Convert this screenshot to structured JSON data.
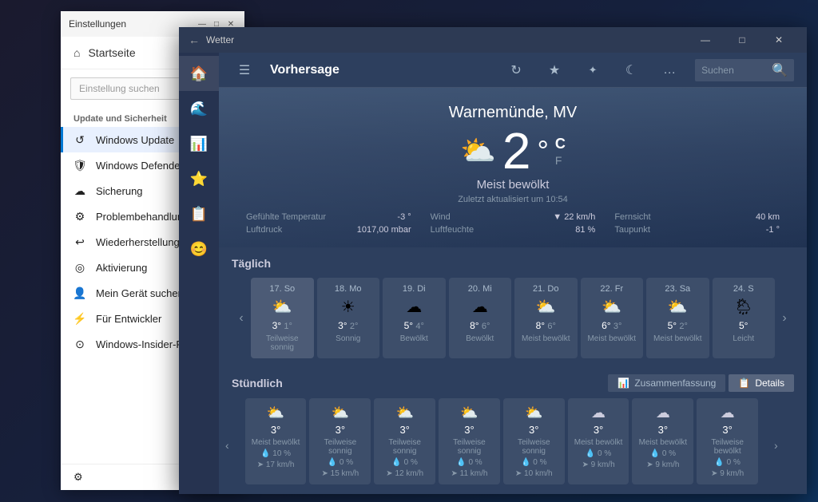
{
  "desktop": {
    "bg": "#1a1a2e"
  },
  "settings": {
    "title": "Einstellungen",
    "home_label": "Startseite",
    "search_placeholder": "Einstellung suchen",
    "section_label": "Update und Sicherheit",
    "nav_items": [
      {
        "id": "windows-update",
        "icon": "↺",
        "label": "Windows Update",
        "active": true
      },
      {
        "id": "windows-defender",
        "icon": "🛡",
        "label": "Windows Defender",
        "active": false
      },
      {
        "id": "sicherung",
        "icon": "↑",
        "label": "Sicherung",
        "active": false
      },
      {
        "id": "problembehandlung",
        "icon": "⚙",
        "label": "Problembehandlung",
        "active": false
      },
      {
        "id": "wiederherstellung",
        "icon": "↩",
        "label": "Wiederherstellung",
        "active": false
      },
      {
        "id": "aktivierung",
        "icon": "◎",
        "label": "Aktivierung",
        "active": false
      },
      {
        "id": "mein-gerat",
        "icon": "👤",
        "label": "Mein Gerät suchen",
        "active": false
      },
      {
        "id": "entwickler",
        "icon": "⚡",
        "label": "Für Entwickler",
        "active": false
      },
      {
        "id": "windows-insider",
        "icon": "⊙",
        "label": "Windows-Insider-Pr...",
        "active": false
      }
    ],
    "bottom_icon": "⚙",
    "bottom_label": ""
  },
  "weather": {
    "titlebar": {
      "back_icon": "←",
      "title": "Wetter",
      "min_icon": "—",
      "max_icon": "□",
      "close_icon": "✕"
    },
    "topbar": {
      "menu_icon": "☰",
      "title": "Vorhersage",
      "refresh_icon": "↻",
      "favorites_icon": "★",
      "settings_icon": "✦",
      "moon_icon": "☾",
      "more_icon": "…",
      "search_placeholder": "Suchen",
      "search_icon": "🔍"
    },
    "sidebar_icons": [
      "🏠",
      "🌊",
      "📊",
      "⭐",
      "📋",
      "😊"
    ],
    "hero": {
      "location": "Warnemünde, MV",
      "temp": "2",
      "unit_c": "C",
      "unit_f": "F",
      "condition": "Meist bewölkt",
      "updated": "Zuletzt aktualisiert um 10:54",
      "details": [
        {
          "label": "Gefühlte Temperatur",
          "value": "-3 °"
        },
        {
          "label": "Wind",
          "value": "▼ 22 km/h"
        },
        {
          "label": "Fernsicht",
          "value": "40 km"
        },
        {
          "label": "Luftdruck",
          "value": "1017,00 mbar"
        },
        {
          "label": "Luftfeuchte",
          "value": "81 %"
        },
        {
          "label": "Taupunkt",
          "value": "-1 °"
        }
      ]
    },
    "daily": {
      "title": "Täglich",
      "days": [
        {
          "name": "17. So",
          "icon": "⛅",
          "high": "3°",
          "low": "1°",
          "label": "Teilweise sonnig",
          "today": true
        },
        {
          "name": "18. Mo",
          "icon": "☀",
          "high": "3°",
          "low": "2°",
          "label": "Sonnig",
          "today": false
        },
        {
          "name": "19. Di",
          "icon": "☁",
          "high": "5°",
          "low": "4°",
          "label": "Bewölkt",
          "today": false
        },
        {
          "name": "20. Mi",
          "icon": "☁",
          "high": "8°",
          "low": "6°",
          "label": "Bewölkt",
          "today": false
        },
        {
          "name": "21. Do",
          "icon": "⛅",
          "high": "8°",
          "low": "6°",
          "label": "Meist bewölkt",
          "today": false
        },
        {
          "name": "22. Fr",
          "icon": "⛅",
          "high": "6°",
          "low": "3°",
          "label": "Meist bewölkt",
          "today": false
        },
        {
          "name": "23. Sa",
          "icon": "⛅",
          "high": "5°",
          "low": "2°",
          "label": "Meist bewölkt",
          "today": false
        },
        {
          "name": "24. S",
          "icon": "🌦",
          "high": "5°",
          "low": "",
          "label": "Leicht",
          "today": false
        }
      ]
    },
    "hourly": {
      "title": "Stündlich",
      "tab_summary": "Zusammenfassung",
      "tab_details": "Details",
      "tab_summary_icon": "📊",
      "tab_details_icon": "📋",
      "hours": [
        {
          "icon": "⛅",
          "temp": "3°",
          "label": "Meist bewölkt",
          "rain": "10 %",
          "wind": "17 km/h"
        },
        {
          "icon": "⛅",
          "temp": "3°",
          "label": "Teilweise sonnig",
          "rain": "0 %",
          "wind": "15 km/h"
        },
        {
          "icon": "⛅",
          "temp": "3°",
          "label": "Teilweise sonnig",
          "rain": "0 %",
          "wind": "12 km/h"
        },
        {
          "icon": "⛅",
          "temp": "3°",
          "label": "Teilweise sonnig",
          "rain": "0 %",
          "wind": "11 km/h"
        },
        {
          "icon": "⛅",
          "temp": "3°",
          "label": "Teilweise sonnig",
          "rain": "0 %",
          "wind": "10 km/h"
        },
        {
          "icon": "☁",
          "temp": "3°",
          "label": "Meist bewölkt",
          "rain": "0 %",
          "wind": "9 km/h"
        },
        {
          "icon": "☁",
          "temp": "3°",
          "label": "Meist bewölkt",
          "rain": "0 %",
          "wind": "9 km/h"
        },
        {
          "icon": "☁",
          "temp": "3°",
          "label": "Teilweise bewölkt",
          "rain": "0 %",
          "wind": "9 km/h"
        }
      ]
    }
  }
}
